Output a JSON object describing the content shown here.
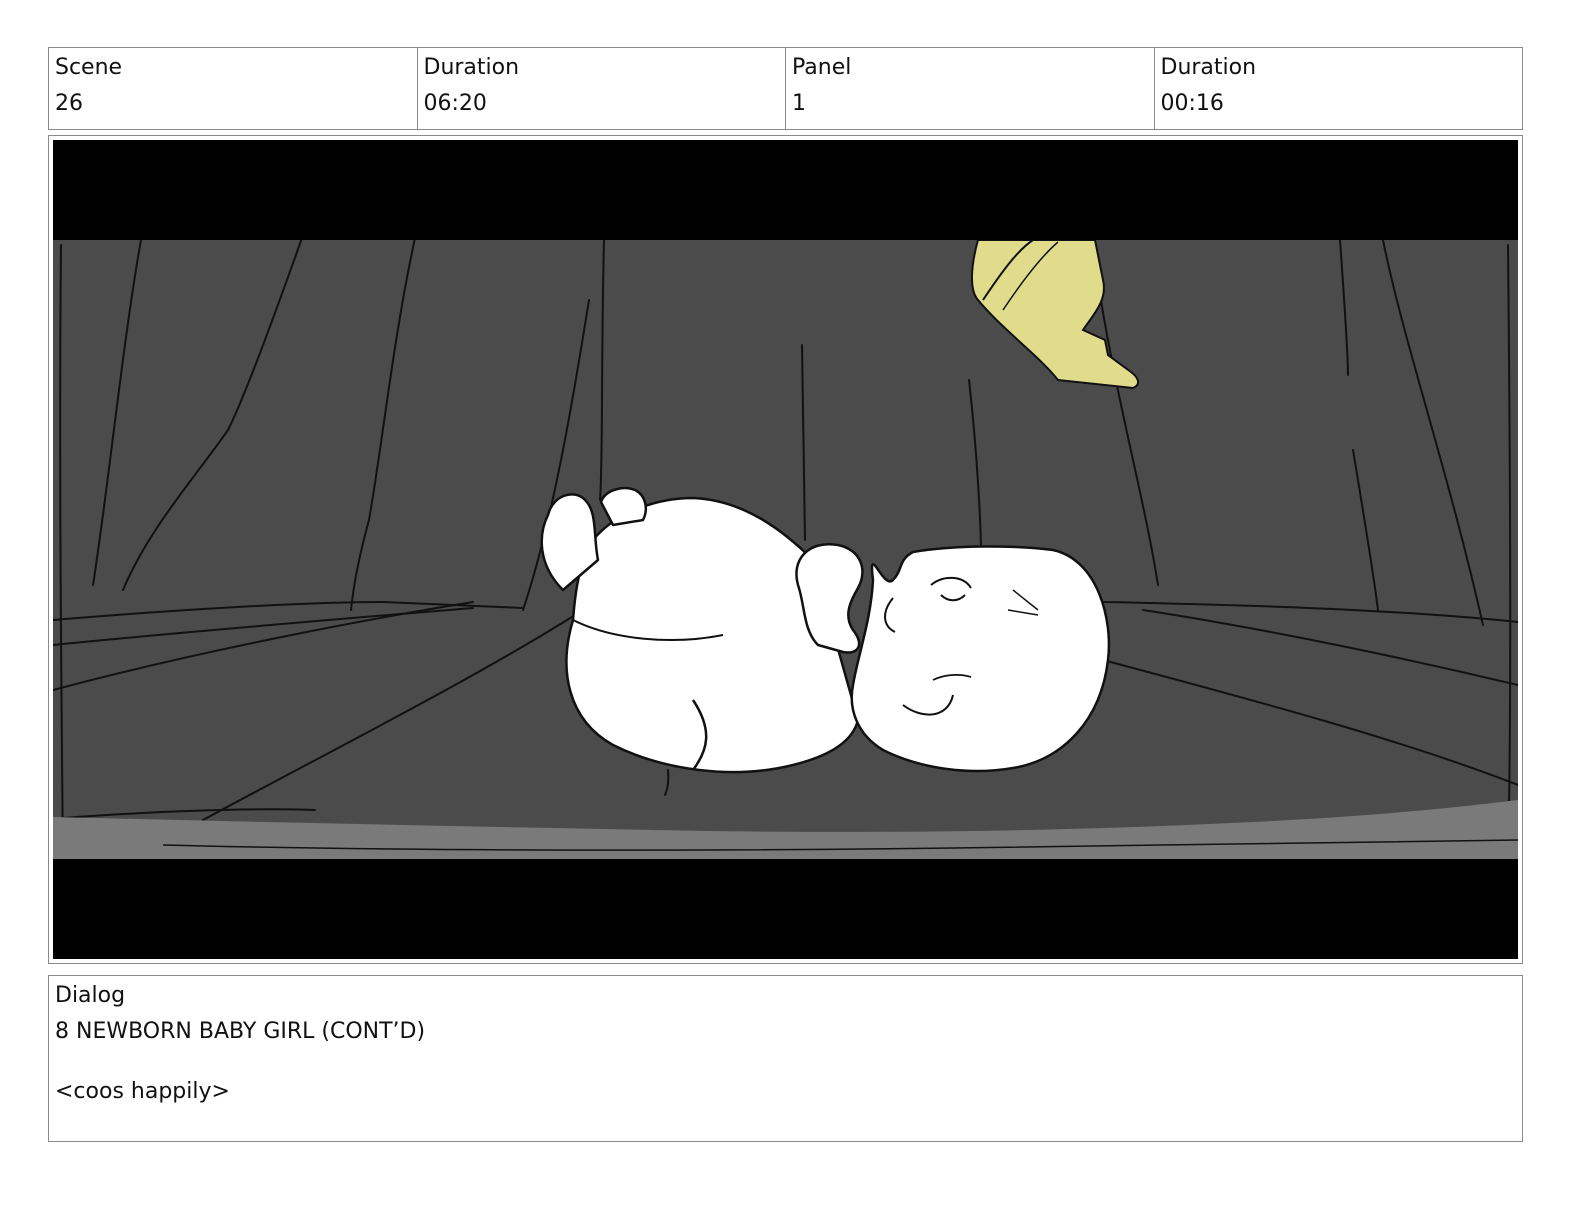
{
  "header": {
    "scene_label": "Scene",
    "scene_value": "26",
    "scene_duration_label": "Duration",
    "scene_duration_value": "06:20",
    "panel_label": "Panel",
    "panel_value": "1",
    "panel_duration_label": "Duration",
    "panel_duration_value": "00:16"
  },
  "panel": {
    "colors": {
      "letterbox": "#000000",
      "background": "#4b4b4b",
      "floor_band": "#7a7a7a",
      "line": "#111111",
      "baby": "#ffffff",
      "butterfly": "#e0dc8c"
    },
    "icons": [
      "newborn-baby-drawing",
      "butterfly-drawing"
    ]
  },
  "dialog": {
    "label": "Dialog",
    "speaker": "8 NEWBORN BABY GIRL (CONT’D)",
    "line": "<coos happily>"
  }
}
